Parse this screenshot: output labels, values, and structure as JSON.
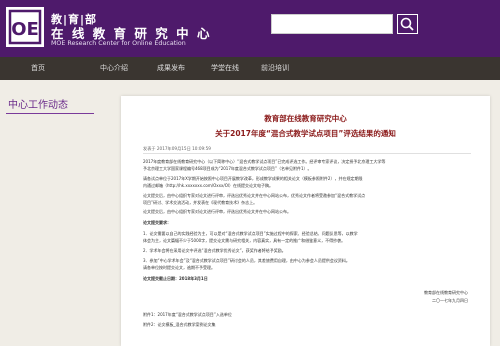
{
  "header": {
    "title": "教|育|部",
    "title2": "在 线 教 育 研 究 中 心",
    "subtitle": "MOE Research Center for Online Education",
    "search_icon": "search-icon",
    "logo_icon": "moe-logo-icon",
    "brand_color": "#4e1a6b"
  },
  "nav": {
    "items": [
      "首页",
      "中心介绍",
      "成果发布",
      "学堂在线",
      "前沿培训"
    ]
  },
  "sidebar": {
    "title": "中心工作动态"
  },
  "article": {
    "title1": "教育部在线教育研究中心",
    "title2": "关于2017年度“混合式教学试点项目”评选结果的通知",
    "meta": "发表于 2017年09月15日 10:09:59",
    "paragraphs": [
      "2017年度教育部在线教育研究中心（以下简称中心）“混合式教学试点项目”已完成评选工作。经评审专家评议，决定授予北京理工大学等",
      "予北京理工大学国家课程编号468项目成为“2017年度混合式教学试点项目”（名单见附件1）。",
      "请各试点单位于2017年X学期开始按照中心项目开展教学改革，形成教学成果的相关论文（模板参照附件2），并在规定期限",
      "内通过邮箱（http://hk.xxxxxxx.com/Oxxx/Ol）在线提交论文电子稿。",
      "论文提交后，由中心组织专家对论文进行评审，评选出优秀论文并在中心网站公布，优秀论文作者将受邀参加“混合式教学试点",
      "项目”研讨、学术交流活动，并发表在《现代教育技术》杂志上。",
      "论文提交后，由中心组织专家对论文进行评审，评选出优秀论文并在中心网站公布。",
      "1．论文需要以自己的实践经验为主，可以是对“混合式教学试点项目”实施过程中的探索、经验总结、问题反思等，以教学",
      "体会为主，论文篇幅不少于5000字，提交论文需与研究相关，内容真实，具有一定的推广和借鉴意义，不得抄袭。",
      "2．学术年会将在采用论文中评选“混合式教学优秀论文”，获奖作者将给予奖励。",
      "3．参加“中心学术年会”及“混合式教学试点项目”研讨会的人员，其差旅费用自理，由中心为参会人员提供会议资料。",
      "请各单位按时提交论文，逾期不予受理。"
    ],
    "heading": "论文提交要求：",
    "deadline": "论文提交截止日期：2018年3月1日",
    "signature": "教育部在线教育研究中心",
    "date": "二〇一七年九月四日",
    "attachments": [
      "附件1：2017年度“混合式教学试点项目”入选单位",
      "附件2：论文模板_混合式教学案例论文集"
    ]
  }
}
